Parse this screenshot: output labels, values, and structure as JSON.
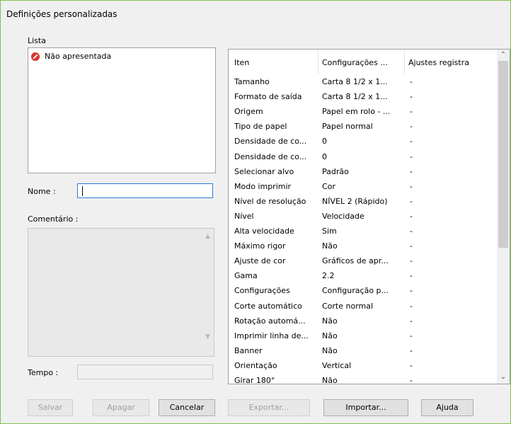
{
  "window": {
    "title": "Definições personalizadas"
  },
  "list": {
    "label": "Lista",
    "items": [
      {
        "label": "Não apresentada",
        "icon": "no-entry-icon"
      }
    ]
  },
  "name": {
    "label": "Nome :",
    "value": ""
  },
  "comment": {
    "label": "Comentário :",
    "value": ""
  },
  "time": {
    "label": "Tempo :",
    "value": ""
  },
  "table": {
    "headers": [
      "Iten",
      "Configurações ...",
      "Ajustes registra"
    ],
    "rows": [
      [
        "Tamanho",
        "Carta 8 1/2 x 1...",
        "-"
      ],
      [
        "Formato de saída",
        "Carta 8 1/2 x 1...",
        "-"
      ],
      [
        "Origem",
        "Papel em rolo - ...",
        "-"
      ],
      [
        "Tipo de papel",
        "Papel normal",
        "-"
      ],
      [
        "Densidade de co...",
        "0",
        "-"
      ],
      [
        "Densidade de co...",
        "0",
        "-"
      ],
      [
        "Selecionar alvo",
        "Padrão",
        "-"
      ],
      [
        "Modo imprimir",
        "Cor",
        "-"
      ],
      [
        "Nível de resolução",
        "NÍVEL 2 (Rápido)",
        "-"
      ],
      [
        "Nível",
        "Velocidade",
        "-"
      ],
      [
        "Alta velocidade",
        "Sim",
        "-"
      ],
      [
        "Máximo rigor",
        "Não",
        "-"
      ],
      [
        "Ajuste de cor",
        "Gráficos de apr...",
        "-"
      ],
      [
        "Gama",
        "2.2",
        "-"
      ],
      [
        "Configurações",
        "Configuração p...",
        "-"
      ],
      [
        "Corte automático",
        "Corte normal",
        "-"
      ],
      [
        "Rotação automá...",
        "Não",
        "-"
      ],
      [
        "Imprimir linha de...",
        "Não",
        "-"
      ],
      [
        "Banner",
        "Não",
        "-"
      ],
      [
        "Orientação",
        "Vertical",
        "-"
      ],
      [
        "Girar 180°",
        "Não",
        "-"
      ]
    ]
  },
  "buttons": {
    "save": "Salvar",
    "delete": "Apagar",
    "cancel": "Cancelar",
    "export": "Exportar...",
    "import": "Importar...",
    "help": "Ajuda"
  },
  "colors": {
    "window_border": "#7ec24a",
    "focus_border": "#2c7bd6",
    "no_icon": "#d9342b"
  }
}
